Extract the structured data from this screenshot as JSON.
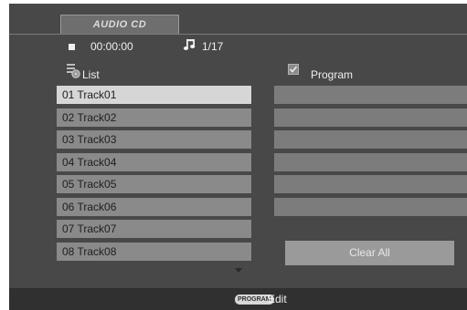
{
  "header": {
    "tab_label": "AUDIO CD"
  },
  "status": {
    "time": "00:00:00",
    "track_counter": "1/17"
  },
  "list": {
    "label": "List",
    "tracks": [
      "01 Track01",
      "02 Track02",
      "03 Track03",
      "04 Track04",
      "05 Track05",
      "06 Track06",
      "07 Track07",
      "08 Track08"
    ],
    "selected_index": 0
  },
  "program": {
    "label": "Program",
    "checked": true,
    "clear_all_label": "Clear All"
  },
  "footer": {
    "key_label": "PROGRAM",
    "action_label": "Edit"
  },
  "icons": {
    "stop": "stop-icon",
    "note": "music-note-icon",
    "list": "list-icon",
    "scroll": "scroll-down-arrow-icon"
  }
}
